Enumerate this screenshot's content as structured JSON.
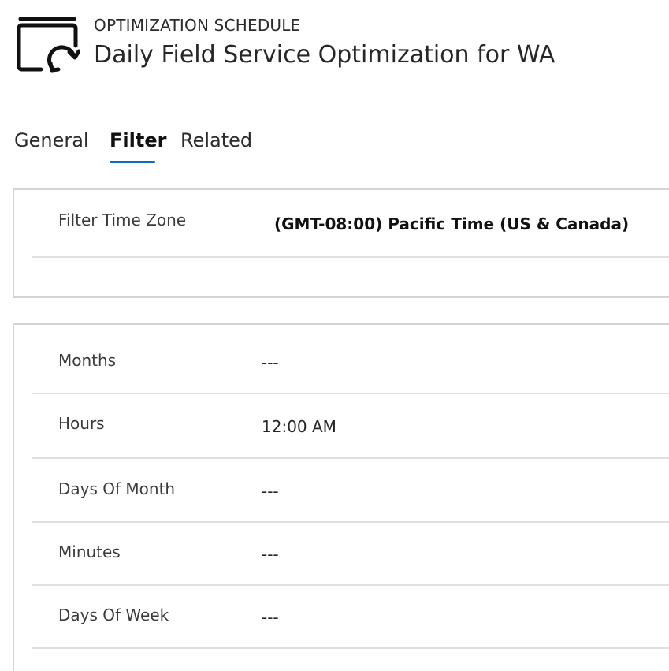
{
  "header": {
    "entity_type": "OPTIMIZATION SCHEDULE",
    "title": "Daily Field Service Optimization for WA",
    "icon": "schedule-refresh-icon"
  },
  "tabs": [
    {
      "label": "General",
      "active": false
    },
    {
      "label": "Filter",
      "active": true
    },
    {
      "label": "Related",
      "active": false
    }
  ],
  "filter_section": {
    "fields": [
      {
        "label": "Filter Time Zone",
        "value": "(GMT-08:00) Pacific Time (US & Canada)"
      }
    ]
  },
  "schedule_section": {
    "fields": [
      {
        "label": "Months",
        "value": "---"
      },
      {
        "label": "Hours",
        "value": "12:00 AM"
      },
      {
        "label": "Days Of Month",
        "value": "---"
      },
      {
        "label": "Minutes",
        "value": "---"
      },
      {
        "label": "Days Of Week",
        "value": "---"
      }
    ]
  },
  "colors": {
    "accent": "#0f6cbd",
    "border": "#d4d4d4",
    "divider": "#e0e0e0"
  }
}
